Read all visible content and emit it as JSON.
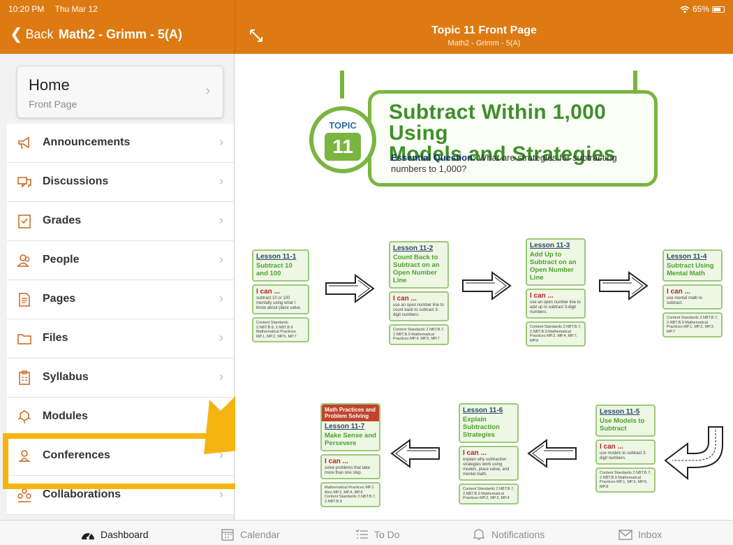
{
  "status": {
    "time": "10:20 PM",
    "date": "Thu Mar 12",
    "battery": "65%"
  },
  "header": {
    "back_label": "Back",
    "course_title": "Math2 - Grimm - 5(A)",
    "page_title": "Topic 11 Front Page",
    "page_subtitle": "Math2 - Grimm - 5(A)",
    "accent_color": "#dd7a12"
  },
  "sidebar": {
    "home": {
      "title": "Home",
      "subtitle": "Front Page"
    },
    "items": [
      {
        "label": "Announcements",
        "icon": "megaphone-icon"
      },
      {
        "label": "Discussions",
        "icon": "chat-bubbles-icon"
      },
      {
        "label": "Grades",
        "icon": "grades-icon"
      },
      {
        "label": "People",
        "icon": "people-icon"
      },
      {
        "label": "Pages",
        "icon": "page-icon"
      },
      {
        "label": "Files",
        "icon": "folder-icon"
      },
      {
        "label": "Syllabus",
        "icon": "clipboard-icon"
      },
      {
        "label": "Modules",
        "icon": "modules-icon"
      },
      {
        "label": "Conferences",
        "icon": "conference-icon"
      },
      {
        "label": "Collaborations",
        "icon": "collaborations-icon"
      }
    ],
    "highlight_color": "#f6b413"
  },
  "content": {
    "topic_word": "TOPIC",
    "topic_number": "11",
    "banner_title_line1": "Subtract Within 1,000 Using",
    "banner_title_line2": "Models and Strategies",
    "essential_label": "Essential Question:",
    "essential_text": "What are strategies for subtracting numbers to 1,000?",
    "lessons": [
      {
        "num": "Lesson 11-1",
        "title": "Subtract 10 and 100",
        "ican": "I can ...",
        "text": "subtract 10 or 100 mentally using what I know about place value.",
        "std": "Content Standards 2.NBT.B.8, 2.NBT.B.9 Mathematical Practices MP.1, MP.2, MP.5, MP.7"
      },
      {
        "num": "Lesson 11-2",
        "title": "Count Back to Subtract on an Open Number Line",
        "ican": "I can ...",
        "text": "use an open number line to count back to subtract 3-digit numbers.",
        "std": "Content Standards 2.NBT.B.7, 2.NBT.B.9 Mathematical Practices MP.4, MP.5, MP.7"
      },
      {
        "num": "Lesson 11-3",
        "title": "Add Up to Subtract on an Open Number Line",
        "ican": "I can ...",
        "text": "use an open number line to add up to subtract 3-digit numbers.",
        "std": "Content Standards 2.NBT.B.7, 2.NBT.B.9 Mathematical Practices MP.2, MP.4, MP.7, MP.8"
      },
      {
        "num": "Lesson 11-4",
        "title": "Subtract Using Mental Math",
        "ican": "I can ...",
        "text": "use mental math to subtract.",
        "std": "Content Standards 2.NBT.B.7, 2.NBT.B.9 Mathematical Practices MP.1, MP.2, MP.3, MP.7"
      },
      {
        "num": "Lesson 11-5",
        "title": "Use Models to Subtract",
        "ican": "I can ...",
        "text": "use models to subtract 3-digit numbers.",
        "std": "Content Standards 2.NBT.B.7, 2.NBT.B.9 Mathematical Practices MP.1, MP.3, MP.5, MP.8"
      },
      {
        "num": "Lesson 11-6",
        "title": "Explain Subtraction Strategies",
        "ican": "I can ...",
        "text": "explain why subtraction strategies work using models, place value, and mental math.",
        "std": "Content Standards 2.NBT.B.7, 2.NBT.B.9 Mathematical Practices MP.2, MP.3, MP.4"
      },
      {
        "num": "Lesson 11-7",
        "title": "Make Sense and Persevere",
        "ican": "I can ...",
        "text": "solve problems that take more than one step.",
        "std": "Mathematical Practices MP.1 Also MP.2, MP.4, MP.6 Content Standards 2.NBT.B.7, 2.NBT.B.9",
        "practice_label": "Math Practices and Problem Solving"
      }
    ]
  },
  "tabbar": {
    "tabs": [
      {
        "label": "Dashboard",
        "icon": "dashboard-icon",
        "active": true
      },
      {
        "label": "Calendar",
        "icon": "calendar-icon"
      },
      {
        "label": "To Do",
        "icon": "todo-icon"
      },
      {
        "label": "Notifications",
        "icon": "bell-icon"
      },
      {
        "label": "Inbox",
        "icon": "envelope-icon"
      }
    ]
  }
}
